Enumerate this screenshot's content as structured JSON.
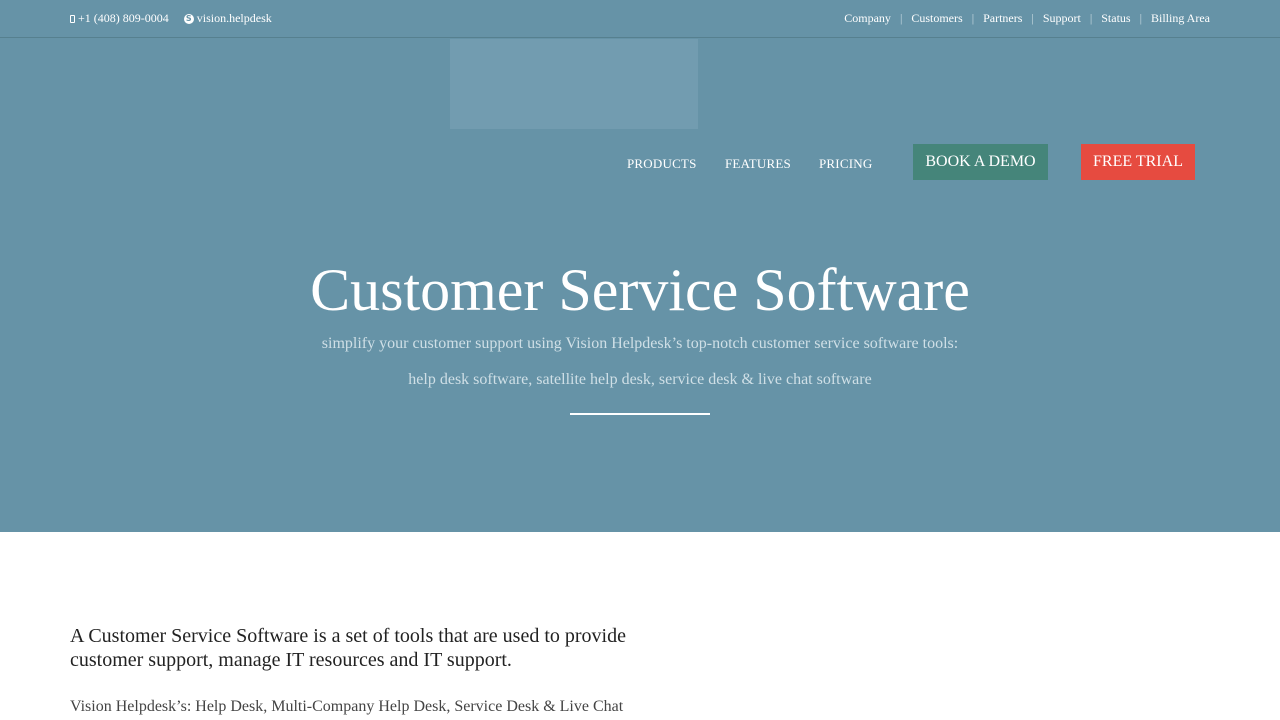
{
  "topbar": {
    "phone": "+1 (408) 809-0004",
    "skype": "vision.helpdesk",
    "links": [
      "Company",
      "Customers",
      "Partners",
      "Support",
      "Status",
      "Billing Area"
    ],
    "separator": "|"
  },
  "nav": {
    "products": "PRODUCTS",
    "features": "FEATURES",
    "pricing": "PRICING",
    "book_demo": "BOOK A DEMO",
    "free_trial": "FREE TRIAL"
  },
  "hero": {
    "title": "Customer Service Software",
    "subtitle_line1": "simplify your customer support using Vision Helpdesk’s top-notch customer service software tools:",
    "subtitle_line2": "help desk software, satellite help desk, service desk & live chat software"
  },
  "content": {
    "heading": "A Customer Service Software is a set of tools that are used to provide customer support, manage IT resources and IT support.",
    "paragraph": "Vision Helpdesk’s: Help Desk, Multi-Company Help Desk, Service Desk & Live Chat"
  },
  "colors": {
    "hero_bg": "#6693a7",
    "demo_button": "#45857a",
    "trial_button": "#e64b40"
  },
  "icons": {
    "phone": "phone-icon",
    "skype": "skype-icon"
  }
}
